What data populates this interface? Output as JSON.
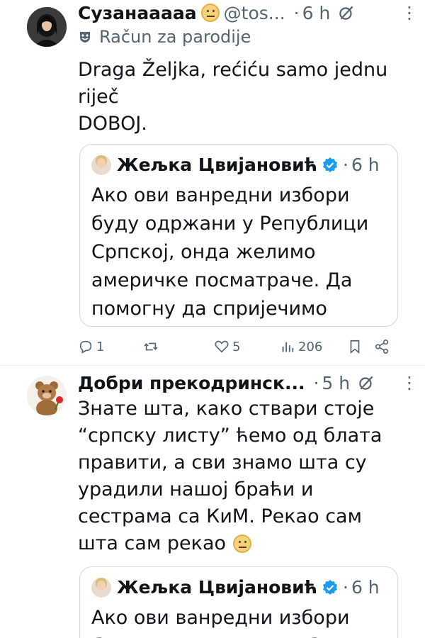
{
  "tweet1": {
    "display_name": "Сузанааааа",
    "handle": "@tos...",
    "sep": "·",
    "time": "6 h",
    "label": "Račun za parodije",
    "text_lines": [
      "Draga Željka, rećiću samo jednu",
      "riječ",
      "DOBOJ."
    ],
    "quote": {
      "author": "Жељка Цвијановић",
      "sep": "·",
      "time": "6 h",
      "text_lines": [
        "Ако ови ванредни избори",
        "буду одржани у Републици",
        "Српској, онда желимо",
        "америчке посматраче. Да",
        "помогну да спријечимо ман..."
      ]
    },
    "actions": {
      "replies": "1",
      "retweets": "",
      "likes": "5",
      "views": "206"
    }
  },
  "tweet2": {
    "display_name": "Добри прекодринск...",
    "sep": "·",
    "time": "5 h",
    "text_lines": [
      "Знате шта, како ствари стоје",
      "“српску листу” ћемо од блата",
      "правити, а сви знамо шта су",
      "урадили нашој браћи и",
      "сестрама са КиМ. Рекао сам",
      "шта сам рекао"
    ],
    "quote": {
      "author": "Жељка Цвијановић",
      "sep": "·",
      "time": "6 h",
      "text_lines": [
        "Ако ови ванредни избори",
        "буду одржани у Републици"
      ]
    }
  },
  "colors": {
    "text": "#0f1419",
    "secondary": "#536471",
    "verified": "#1d9bf0",
    "border": "#cfd9de"
  }
}
